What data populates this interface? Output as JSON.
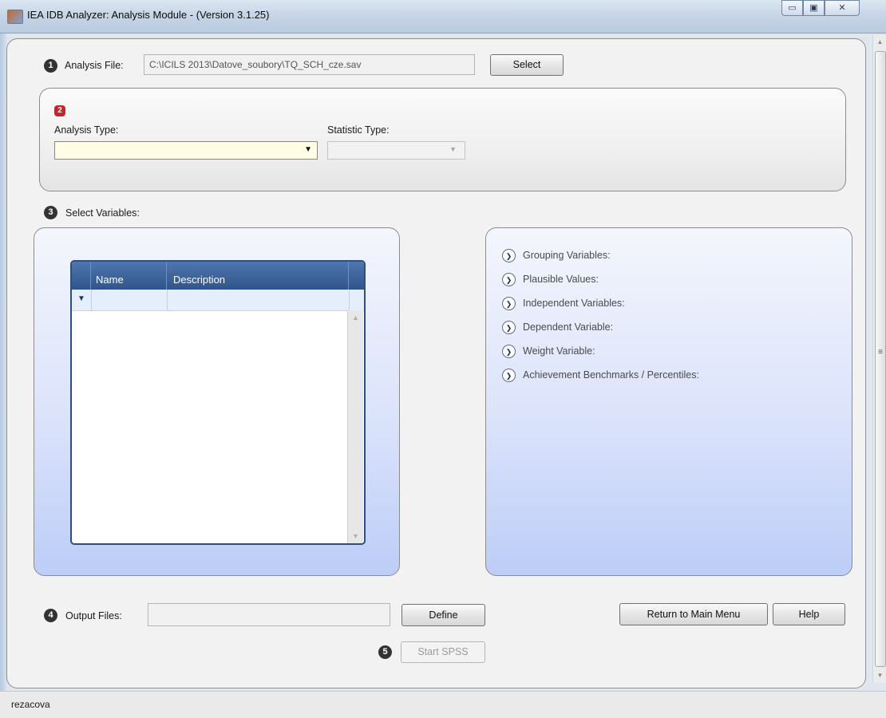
{
  "window": {
    "title": "IEA IDB Analyzer: Analysis Module - (Version 3.1.25)",
    "minimize_glyph": "▭",
    "maximize_glyph": "▣",
    "close_glyph": "✕"
  },
  "steps": {
    "step1": {
      "badge": "1",
      "label": "Analysis File:",
      "value": "C:\\ICILS 2013\\Datove_soubory\\TQ_SCH_cze.sav",
      "button": "Select"
    },
    "step2": {
      "badge": "2",
      "analysis_type_label": "Analysis Type:",
      "analysis_type_value": "",
      "statistic_type_label": "Statistic Type:",
      "statistic_type_value": ""
    },
    "step3": {
      "badge": "3",
      "label": "Select Variables:"
    },
    "step4": {
      "badge": "4",
      "label": "Output Files:",
      "value": "",
      "button": "Define"
    },
    "step5": {
      "badge": "5",
      "button": "Start SPSS"
    }
  },
  "grid": {
    "columns": [
      "Name",
      "Description"
    ],
    "rows": []
  },
  "variable_sections": [
    "Grouping Variables:",
    "Plausible Values:",
    "Independent Variables:",
    "Dependent Variable:",
    "Weight Variable:",
    "Achievement Benchmarks / Percentiles:"
  ],
  "buttons": {
    "return_main_menu": "Return to Main Menu",
    "help": "Help"
  },
  "status": {
    "user": "rezacova"
  },
  "colors": {
    "panel_gradient_top": "#f4f6fd",
    "panel_gradient_bottom": "#bccdf7",
    "grid_header": "#2f558c",
    "combo_highlight": "#fffde6",
    "step2_badge": "#c1272d"
  },
  "icons": {
    "section_toggle": "chevron-down-circle-icon",
    "grid_filter": "filter-icon",
    "app": "app-icon"
  }
}
